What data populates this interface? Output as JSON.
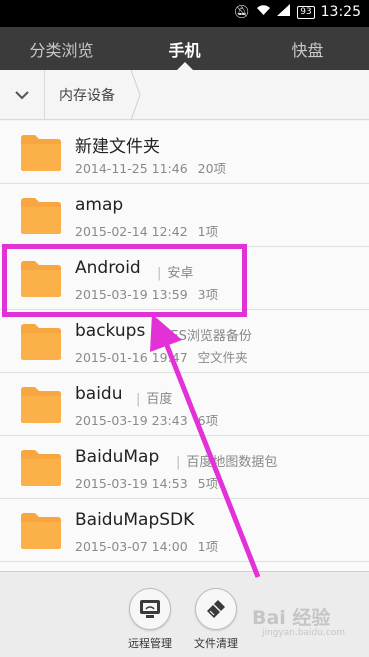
{
  "status_bar": {
    "time": "13:25",
    "battery": "93"
  },
  "tabs": [
    {
      "label": "分类浏览",
      "active": false
    },
    {
      "label": "手机",
      "active": true
    },
    {
      "label": "快盘",
      "active": false
    }
  ],
  "path_bar": {
    "crumb": "内存设备"
  },
  "files": [
    {
      "name": "新建文件夹",
      "tag": "",
      "date": "2014-11-25 11:46",
      "count": "20项"
    },
    {
      "name": "amap",
      "tag": "",
      "date": "2015-02-14 12:42",
      "count": "1项"
    },
    {
      "name": "Android",
      "tag": "安卓",
      "date": "2015-03-19 13:59",
      "count": "3项"
    },
    {
      "name": "backups",
      "tag": "ES浏览器备份",
      "date": "2015-01-16 19:47",
      "count": "空文件夹"
    },
    {
      "name": "baidu",
      "tag": "百度",
      "date": "2015-03-19 23:43",
      "count": "6项"
    },
    {
      "name": "BaiduMap",
      "tag": "百度地图数据包",
      "date": "2015-03-19 14:53",
      "count": "5项"
    },
    {
      "name": "BaiduMapSDK",
      "tag": "",
      "date": "2015-03-07 14:00",
      "count": "1项"
    }
  ],
  "bottom_actions": [
    {
      "label": "远程管理",
      "icon": "remote-manage-icon"
    },
    {
      "label": "文件清理",
      "icon": "file-clean-icon"
    }
  ],
  "annotation": {
    "highlight_color": "#e331d8"
  },
  "watermark": {
    "text": "Bai 经验",
    "sub": "jingyan.baidu.com"
  }
}
